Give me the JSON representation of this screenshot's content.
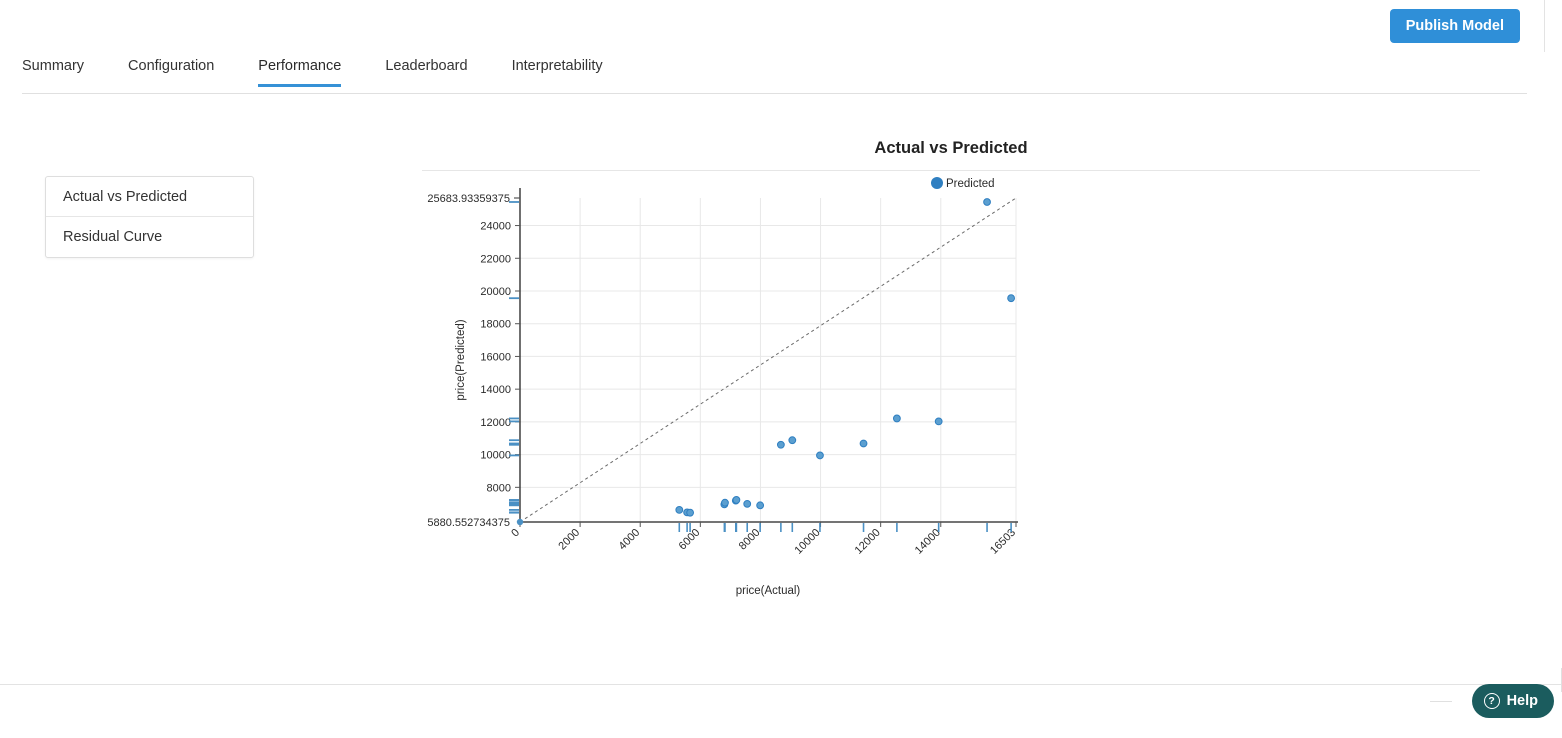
{
  "topbar": {
    "publish_label": "Publish Model",
    "publish_color": "#2f8fd8"
  },
  "tabs": {
    "active": "Performance",
    "accent_color": "#3591d6",
    "items": [
      {
        "label": "Summary"
      },
      {
        "label": "Configuration"
      },
      {
        "label": "Performance"
      },
      {
        "label": "Leaderboard"
      },
      {
        "label": "Interpretability"
      }
    ]
  },
  "chart_list": {
    "items": [
      {
        "label": "Actual vs Predicted"
      },
      {
        "label": "Residual Curve"
      }
    ]
  },
  "help": {
    "label": "Help",
    "icon": "question-circle-icon",
    "color": "#1b5c5e"
  },
  "chart_data": {
    "type": "scatter",
    "title": "Actual vs Predicted",
    "xlabel": "price(Actual)",
    "ylabel": "price(Predicted)",
    "legend": [
      {
        "name": "Predicted",
        "color": "#2f7fc1"
      }
    ],
    "legend_position": "top-right",
    "grid": true,
    "xlim": [
      0,
      16503
    ],
    "ylim": [
      5880.552734375,
      25683.93359375
    ],
    "x_axis_min_label": "0",
    "x_axis_max_label": "16503",
    "y_axis_min_label": "5880.552734375",
    "y_axis_max_label": "25683.93359375",
    "xticks": [
      0,
      2000,
      4000,
      6000,
      8000,
      10000,
      12000,
      14000,
      16503
    ],
    "xtick_labels": [
      "0",
      "2000",
      "4000",
      "6000",
      "8000",
      "10000",
      "12000",
      "14000",
      "16503"
    ],
    "yticks": [
      8000,
      10000,
      12000,
      14000,
      16000,
      18000,
      20000,
      22000,
      24000
    ],
    "ytick_labels": [
      "8000",
      "10000",
      "12000",
      "14000",
      "16000",
      "18000",
      "20000",
      "22000",
      "24000"
    ],
    "reference_line": {
      "style": "dashed",
      "color": "#6b6b6b",
      "from": [
        0,
        5880.55
      ],
      "to": [
        16503,
        25683.93
      ]
    },
    "series": [
      {
        "name": "Predicted",
        "color": "#3d8fc4",
        "points": [
          {
            "x": 5300,
            "y": 6620
          },
          {
            "x": 5560,
            "y": 6470
          },
          {
            "x": 5660,
            "y": 6450
          },
          {
            "x": 6800,
            "y": 6960
          },
          {
            "x": 6820,
            "y": 7060
          },
          {
            "x": 7180,
            "y": 7190
          },
          {
            "x": 7200,
            "y": 7230
          },
          {
            "x": 7560,
            "y": 6990
          },
          {
            "x": 7990,
            "y": 6900
          },
          {
            "x": 8680,
            "y": 10600
          },
          {
            "x": 9060,
            "y": 10880
          },
          {
            "x": 9980,
            "y": 9950
          },
          {
            "x": 11430,
            "y": 10680
          },
          {
            "x": 12540,
            "y": 12210
          },
          {
            "x": 13930,
            "y": 12030
          },
          {
            "x": 15540,
            "y": 25440
          },
          {
            "x": 16340,
            "y": 19560
          }
        ]
      }
    ],
    "x_rug_values": [
      5300,
      5560,
      5660,
      6800,
      6820,
      7180,
      7200,
      7560,
      7990,
      8680,
      9060,
      9980,
      11430,
      12540,
      13930,
      15540,
      16340
    ],
    "y_rug_values": [
      6450,
      6470,
      6620,
      6900,
      6960,
      6990,
      7060,
      7190,
      7230,
      9950,
      10600,
      10680,
      10880,
      12030,
      12210,
      19560,
      25440
    ]
  }
}
